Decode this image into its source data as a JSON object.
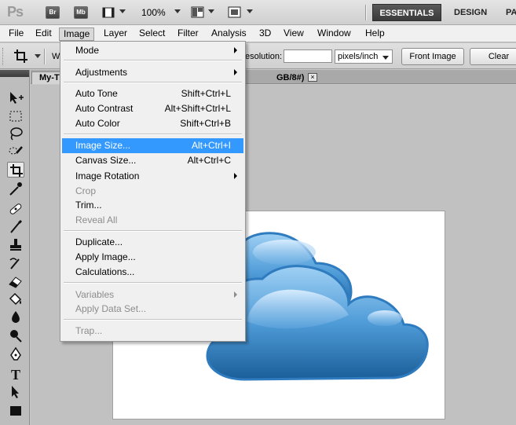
{
  "appbar": {
    "logo": "Ps",
    "bridge_label": "Br",
    "minibridge_label": "Mb",
    "zoom": "100%",
    "workspaces": [
      "ESSENTIALS",
      "DESIGN",
      "PA"
    ]
  },
  "menubar": {
    "items": [
      "File",
      "Edit",
      "Image",
      "Layer",
      "Select",
      "Filter",
      "Analysis",
      "3D",
      "View",
      "Window",
      "Help"
    ]
  },
  "options": {
    "w_label": "W",
    "resolution_label": "esolution:",
    "resolution_value": "",
    "unit": "pixels/inch",
    "front_image": "Front Image",
    "clear": "Clear"
  },
  "document": {
    "tab_title": "My-T",
    "tab_suffix": "GB/8#)",
    "close": "×"
  },
  "image_menu": {
    "mode": "Mode",
    "adjustments": "Adjustments",
    "auto_tone": "Auto Tone",
    "auto_tone_sc": "Shift+Ctrl+L",
    "auto_contrast": "Auto Contrast",
    "auto_contrast_sc": "Alt+Shift+Ctrl+L",
    "auto_color": "Auto Color",
    "auto_color_sc": "Shift+Ctrl+B",
    "image_size": "Image Size...",
    "image_size_sc": "Alt+Ctrl+I",
    "canvas_size": "Canvas Size...",
    "canvas_size_sc": "Alt+Ctrl+C",
    "image_rotation": "Image Rotation",
    "crop": "Crop",
    "trim": "Trim...",
    "reveal_all": "Reveal All",
    "duplicate": "Duplicate...",
    "apply_image": "Apply Image...",
    "calculations": "Calculations...",
    "variables": "Variables",
    "apply_data_set": "Apply Data Set...",
    "trap": "Trap..."
  },
  "colors": {
    "highlight": "#3399ff",
    "cloud_light": "#8ec5ee",
    "cloud_dark": "#1f6fae"
  }
}
